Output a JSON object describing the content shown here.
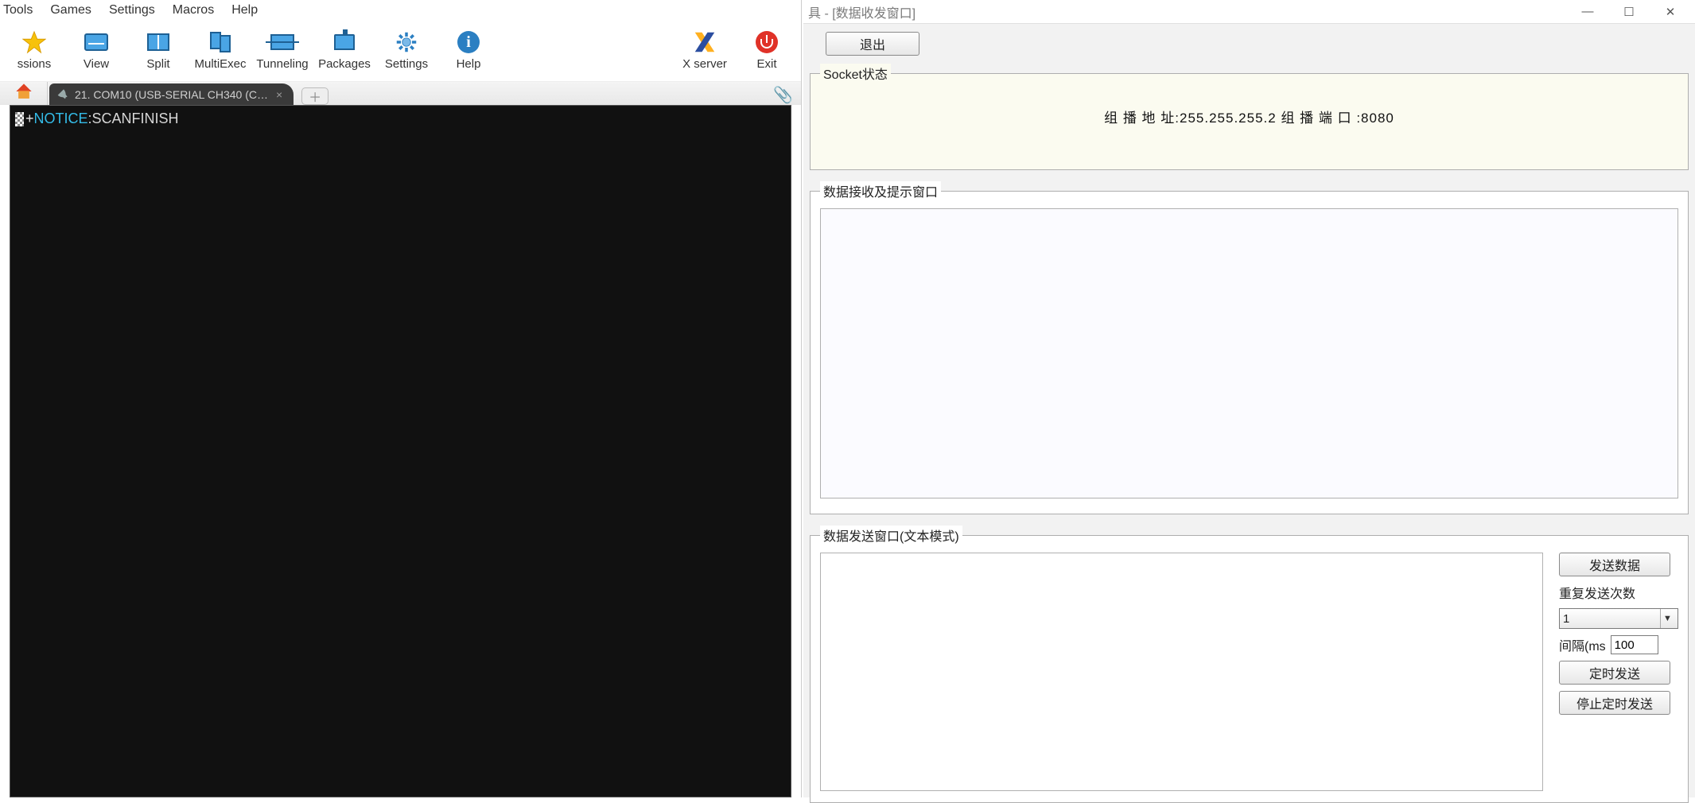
{
  "left": {
    "menubar": [
      "Tools",
      "Games",
      "Settings",
      "Macros",
      "Help"
    ],
    "toolbar_left": [
      {
        "id": "sessions",
        "label": "ssions"
      },
      {
        "id": "view",
        "label": "View"
      },
      {
        "id": "split",
        "label": "Split"
      },
      {
        "id": "multiexec",
        "label": "MultiExec"
      },
      {
        "id": "tunneling",
        "label": "Tunneling"
      },
      {
        "id": "packages",
        "label": "Packages"
      },
      {
        "id": "settings",
        "label": "Settings"
      },
      {
        "id": "help",
        "label": "Help"
      }
    ],
    "toolbar_right": [
      {
        "id": "xserver",
        "label": "X server"
      },
      {
        "id": "exit",
        "label": "Exit"
      }
    ],
    "tab_title": "21. COM10  (USB-SERIAL CH340 (C…",
    "terminal": {
      "plus": "+",
      "keyword": "NOTICE",
      "colon": ":",
      "rest": "SCANFINISH"
    }
  },
  "right": {
    "window_title": "具 - [数据收发窗口]",
    "exit_btn": "退出",
    "groups": {
      "status_legend": "Socket状态",
      "status_line": "组 播 地 址:255.255.255.2 组 播 端 口 :8080",
      "recv_legend": "数据接收及提示窗口",
      "send_legend": "数据发送窗口(文本模式)"
    },
    "send": {
      "send_btn": "发送数据",
      "repeat_label": "重复发送次数",
      "repeat_value": "1",
      "interval_label": "间隔(ms",
      "interval_value": "100",
      "timed_btn": "定时发送",
      "stop_btn": "停止定时发送"
    }
  }
}
